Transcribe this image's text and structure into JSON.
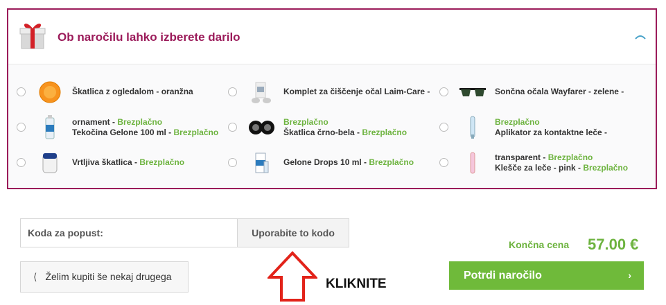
{
  "gift_section": {
    "title": "Ob naročilu lahko izberete darilo",
    "icons": {
      "header": "gift-icon",
      "toggle": "chevron-up-icon"
    },
    "accent_color": "#9b1b5a",
    "items": [
      {
        "lines": [
          {
            "text": "Škatlica z ogledalom - oranžna",
            "free": ""
          }
        ],
        "icon": "orange-mirror-case-icon"
      },
      {
        "lines": [
          {
            "text": "Komplet za čiščenje očal Laim-Care -",
            "free": ""
          }
        ],
        "icon": "glasses-cleaning-kit-icon"
      },
      {
        "lines": [
          {
            "text": "Sončna očala Wayfarer - zelene -",
            "free": ""
          }
        ],
        "icon": "sunglasses-icon"
      },
      {
        "lines": [
          {
            "text": "ornament - ",
            "free": "Brezplačno"
          },
          {
            "text": "Tekočina Gelone 100 ml - ",
            "free": "Brezplačno"
          }
        ],
        "icon": "solution-bottle-icon"
      },
      {
        "lines": [
          {
            "text": "",
            "free": "Brezplačno"
          },
          {
            "text": "Škatlica črno-bela - ",
            "free": "Brezplačno"
          }
        ],
        "icon": "black-white-case-icon"
      },
      {
        "lines": [
          {
            "text": "",
            "free": "Brezplačno"
          },
          {
            "text": "Aplikator za kontaktne leče -",
            "free": ""
          }
        ],
        "icon": "lens-applicator-icon"
      },
      {
        "lines": [
          {
            "text": "Vrtljiva škatlica - ",
            "free": "Brezplačno"
          }
        ],
        "icon": "rotating-case-icon"
      },
      {
        "lines": [
          {
            "text": "Gelone Drops 10 ml - ",
            "free": "Brezplačno"
          }
        ],
        "icon": "drops-box-icon"
      },
      {
        "lines": [
          {
            "text": "transparent - ",
            "free": "Brezplačno"
          },
          {
            "text": "Klešče za leče - pink - ",
            "free": "Brezplačno"
          }
        ],
        "icon": "lens-tweezers-icon"
      }
    ]
  },
  "coupon": {
    "label": "Koda za popust:",
    "button": "Uporabite to kodo"
  },
  "back_button": {
    "chevron": "⟨",
    "label": "Želim kupiti še nekaj drugega"
  },
  "annotation": {
    "label": "KLIKNITE",
    "icon": "up-arrow-outline-icon"
  },
  "total": {
    "label": "Končna cena",
    "value": "57.00 €"
  },
  "confirm_button": {
    "label": "Potrdi naročilo",
    "chevron": "›"
  },
  "colors": {
    "green": "#6db33f",
    "button_green": "#6fba3a",
    "border": "#d6d6d6"
  }
}
